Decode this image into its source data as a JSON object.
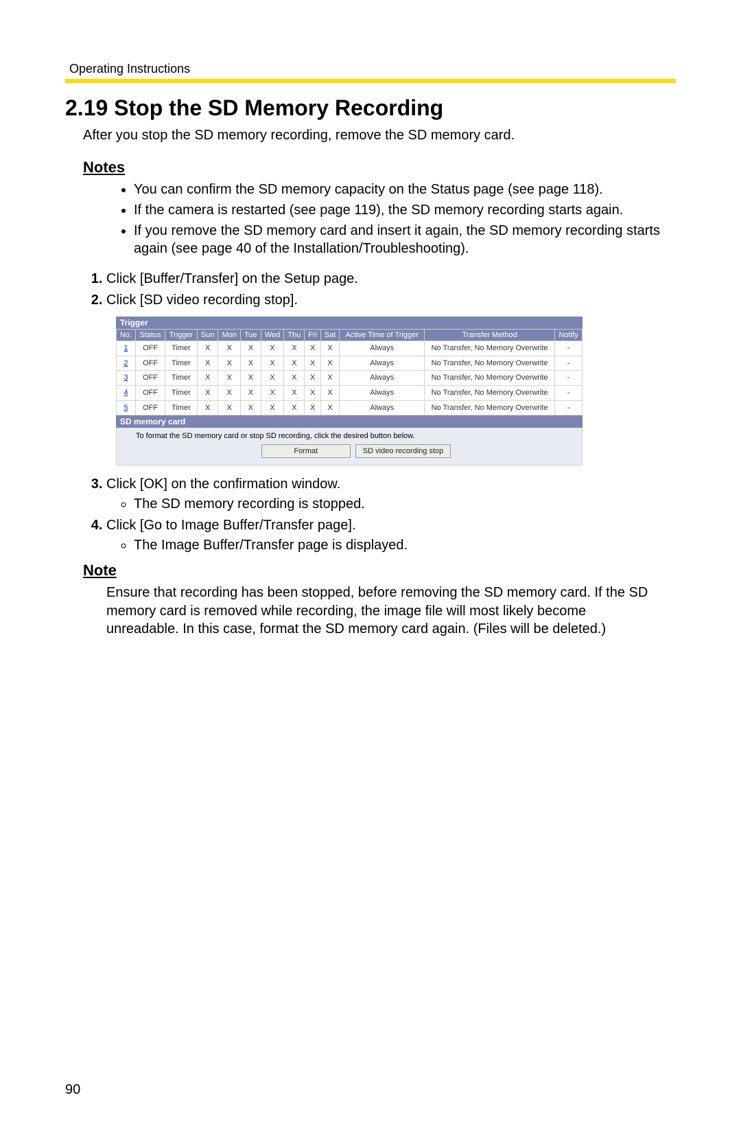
{
  "header": {
    "label": "Operating Instructions"
  },
  "title": "2.19  Stop the SD Memory Recording",
  "intro": "After you stop the SD memory recording, remove the SD memory card.",
  "notes_heading": "Notes",
  "notes": [
    "You can confirm the SD memory capacity on the Status page (see page 118).",
    "If the camera is restarted (see page 119), the SD memory recording starts again.",
    "If you remove the SD memory card and insert it again, the SD memory recording starts again (see page 40 of the Installation/Troubleshooting)."
  ],
  "steps12": [
    "Click [Buffer/Transfer] on the Setup page.",
    "Click [SD video recording stop]."
  ],
  "table": {
    "band": "Trigger",
    "headers": [
      "No.",
      "Status",
      "Trigger",
      "Sun",
      "Mon",
      "Tue",
      "Wed",
      "Thu",
      "Fri",
      "Sat",
      "Active Time of Trigger",
      "Transfer Method",
      "Notify"
    ],
    "rows": [
      {
        "no": "1",
        "status": "OFF",
        "trigger": "Timer",
        "d": [
          "X",
          "X",
          "X",
          "X",
          "X",
          "X",
          "X"
        ],
        "active": "Always",
        "method": "No Transfer, No Memory Overwrite",
        "notify": "-"
      },
      {
        "no": "2",
        "status": "OFF",
        "trigger": "Timer",
        "d": [
          "X",
          "X",
          "X",
          "X",
          "X",
          "X",
          "X"
        ],
        "active": "Always",
        "method": "No Transfer, No Memory Overwrite",
        "notify": "-"
      },
      {
        "no": "3",
        "status": "OFF",
        "trigger": "Timer",
        "d": [
          "X",
          "X",
          "X",
          "X",
          "X",
          "X",
          "X"
        ],
        "active": "Always",
        "method": "No Transfer, No Memory Overwrite",
        "notify": "-"
      },
      {
        "no": "4",
        "status": "OFF",
        "trigger": "Timer",
        "d": [
          "X",
          "X",
          "X",
          "X",
          "X",
          "X",
          "X"
        ],
        "active": "Always",
        "method": "No Transfer, No Memory Overwrite",
        "notify": "-"
      },
      {
        "no": "5",
        "status": "OFF",
        "trigger": "Timer",
        "d": [
          "X",
          "X",
          "X",
          "X",
          "X",
          "X",
          "X"
        ],
        "active": "Always",
        "method": "No Transfer, No Memory Overwrite",
        "notify": "-"
      }
    ],
    "sd_band": "SD memory card",
    "sd_instr": "To format the SD memory card or stop SD recording, click the desired button below.",
    "btn_format": "Format",
    "btn_stop": "SD video recording stop"
  },
  "step3": "Click [OK] on the confirmation window.",
  "step3_sub": "The SD memory recording is stopped.",
  "step4": "Click [Go to Image Buffer/Transfer page].",
  "step4_sub": "The Image Buffer/Transfer page is displayed.",
  "note_heading": "Note",
  "note_body": "Ensure that recording has been stopped, before removing the SD memory card. If the SD memory card is removed while recording, the image file will most likely become unreadable. In this case, format the SD memory card again. (Files will be deleted.)",
  "page_number": "90"
}
